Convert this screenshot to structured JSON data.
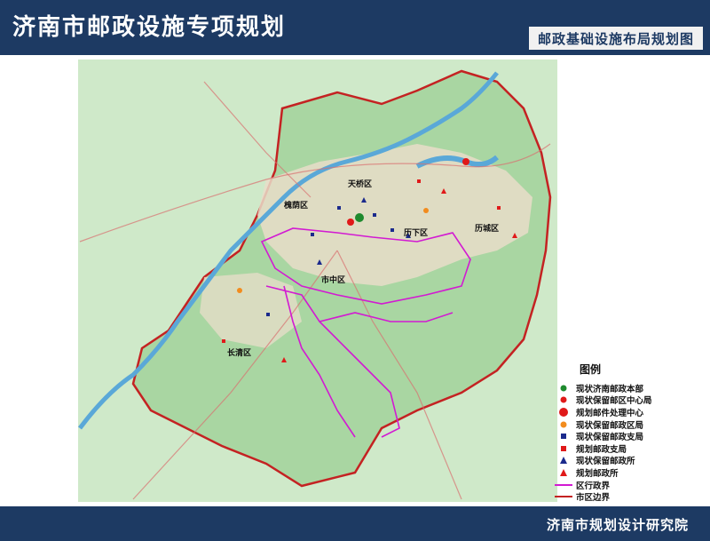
{
  "header": {
    "title": "济南市邮政设施专项规划",
    "subtitle": "邮政基础设施布局规划图"
  },
  "footer": {
    "institute": "济南市规划设计研究院"
  },
  "districts": [
    {
      "name": "天桥区"
    },
    {
      "name": "槐荫区"
    },
    {
      "name": "历下区"
    },
    {
      "name": "历城区"
    },
    {
      "name": "市中区"
    },
    {
      "name": "长清区"
    }
  ],
  "legend": {
    "title": "图例",
    "items": [
      {
        "label": "现状济南邮政本部",
        "symbol": "circle",
        "color": "#1e8a2e"
      },
      {
        "label": "现状保留邮区中心局",
        "symbol": "circle",
        "color": "#e01919"
      },
      {
        "label": "规划邮件处理中心",
        "symbol": "circle-large",
        "color": "#e01919"
      },
      {
        "label": "现状保留邮政区局",
        "symbol": "circle",
        "color": "#f28c1e"
      },
      {
        "label": "现状保留邮政支局",
        "symbol": "square",
        "color": "#1b2a8c"
      },
      {
        "label": "规划邮政支局",
        "symbol": "square",
        "color": "#e01919"
      },
      {
        "label": "现状保留邮政所",
        "symbol": "triangle",
        "color": "#1b2a8c"
      },
      {
        "label": "规划邮政所",
        "symbol": "triangle",
        "color": "#e01919"
      },
      {
        "label": "区行政界",
        "symbol": "line",
        "color": "#d21ad2"
      },
      {
        "label": "市区边界",
        "symbol": "line",
        "color": "#c42222"
      }
    ]
  },
  "colors": {
    "header_bg": "#1d3a63",
    "boundary": "#c42222",
    "district_boundary": "#d21ad2",
    "river": "#5aa8d8",
    "land": "#a9d6a2"
  }
}
